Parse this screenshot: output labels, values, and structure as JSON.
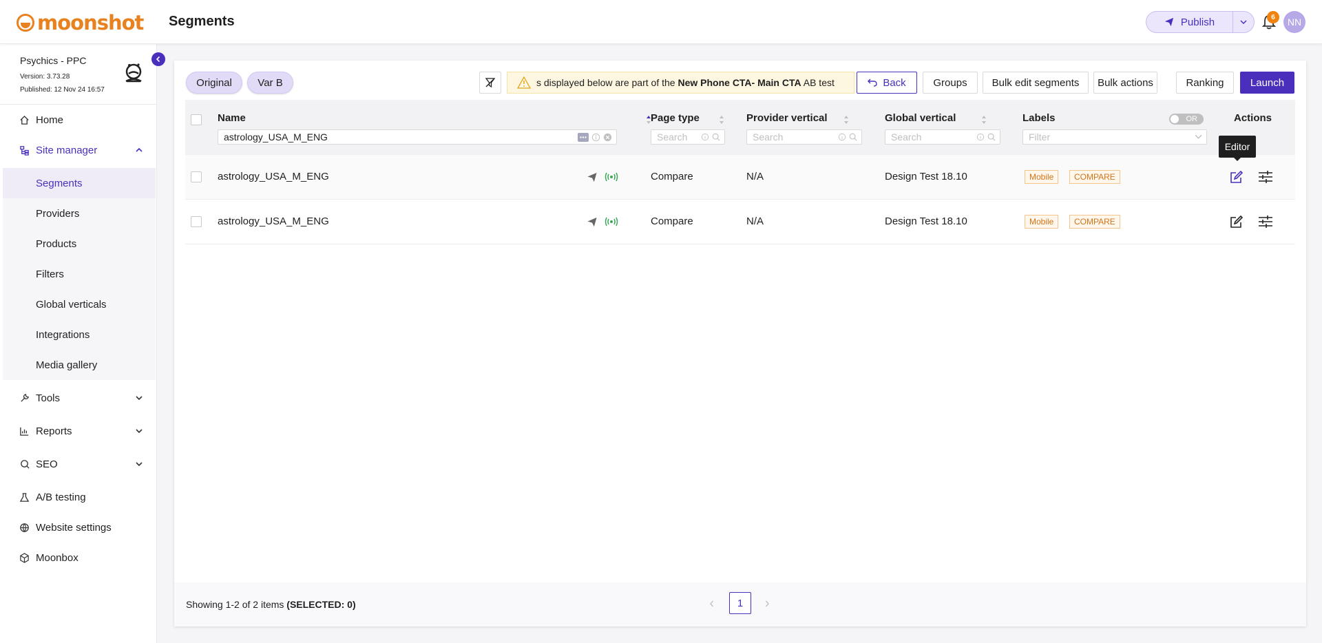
{
  "brand": {
    "name": "moonshot",
    "color": "#e8811f",
    "accent": "#4a2fbd"
  },
  "header": {
    "page_title": "Segments",
    "publish_label": "Publish",
    "notification_count": "6",
    "avatar_initials": "NN"
  },
  "site": {
    "name": "Psychics - PPC",
    "version": "Version: 3.73.28",
    "published": "Published: 12 Nov 24 16:57"
  },
  "sidebar": {
    "items": [
      {
        "label": "Home",
        "icon": "home-icon"
      },
      {
        "label": "Site manager",
        "icon": "sitemap-icon"
      },
      {
        "label": "Tools",
        "icon": "wrench-icon"
      },
      {
        "label": "Reports",
        "icon": "chart-icon"
      },
      {
        "label": "SEO",
        "icon": "seo-icon"
      },
      {
        "label": "A/B testing",
        "icon": "flask-icon"
      },
      {
        "label": "Website settings",
        "icon": "globe-icon"
      },
      {
        "label": "Moonbox",
        "icon": "box-icon"
      }
    ],
    "subitems": [
      "Segments",
      "Providers",
      "Products",
      "Filters",
      "Global verticals",
      "Integrations",
      "Media gallery"
    ]
  },
  "toolbar": {
    "variant_a": "Original",
    "variant_b": "Var B",
    "banner_prefix": "s displayed below are part of the ",
    "banner_test": "New Phone CTA- Main CTA",
    "banner_suffix": " AB test",
    "back": "Back",
    "groups": "Groups",
    "bulk_edit": "Bulk edit segments",
    "bulk_actions": "Bulk actions",
    "ranking": "Ranking",
    "launch": "Launch"
  },
  "table": {
    "columns": {
      "name": "Name",
      "page_type": "Page type",
      "provider_vertical": "Provider vertical",
      "global_vertical": "Global vertical",
      "labels": "Labels",
      "actions": "Actions"
    },
    "filters": {
      "name_value": "astrology_USA_M_ENG",
      "search_placeholder": "Search",
      "labels_placeholder": "Filter",
      "toggle_label": "OR"
    },
    "rows": [
      {
        "name": "astrology_USA_M_ENG",
        "page_type": "Compare",
        "provider_vertical": "N/A",
        "global_vertical": "Design Test 18.10",
        "label_1": "Mobile",
        "label_2": "COMPARE"
      },
      {
        "name": "astrology_USA_M_ENG",
        "page_type": "Compare",
        "provider_vertical": "N/A",
        "global_vertical": "Design Test 18.10",
        "label_1": "Mobile",
        "label_2": "COMPARE"
      }
    ],
    "tooltip": "Editor"
  },
  "footer": {
    "showing": "Showing 1-2 of 2 items ",
    "selected": "(SELECTED: 0)",
    "current_page": "1"
  }
}
